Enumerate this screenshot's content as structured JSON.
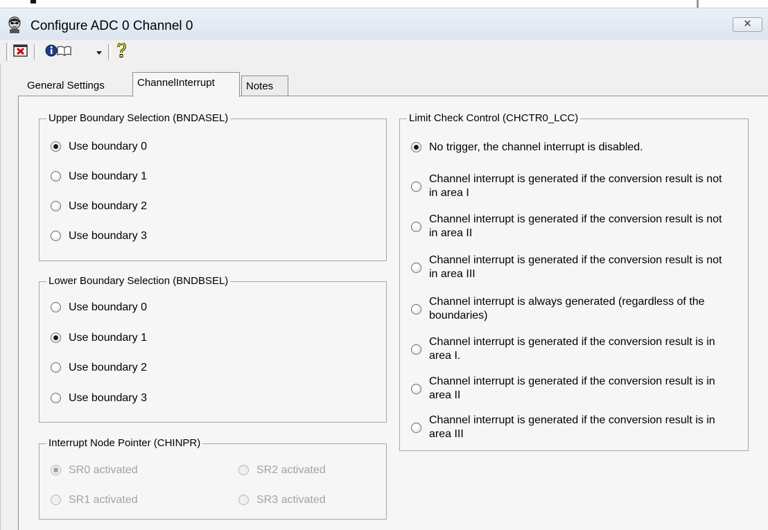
{
  "window": {
    "title": "Configure ADC 0 Channel 0",
    "close_icon": "close-icon"
  },
  "toolbar": {
    "icons": [
      "close-document-icon",
      "info-book-icon",
      "dropdown-arrow-icon",
      "help-icon"
    ]
  },
  "tabs": [
    {
      "label": "General Settings",
      "active": false
    },
    {
      "label": "ChannelInterrupt",
      "active": true
    },
    {
      "label": "Notes",
      "active": false
    }
  ],
  "upper_boundary": {
    "title": "Upper Boundary Selection (BNDASEL)",
    "options": [
      "Use boundary 0",
      "Use boundary 1",
      "Use boundary 2",
      "Use boundary 3"
    ],
    "selected": 0
  },
  "lower_boundary": {
    "title": "Lower Boundary Selection (BNDBSEL)",
    "options": [
      "Use boundary 0",
      "Use boundary 1",
      "Use boundary 2",
      "Use boundary 3"
    ],
    "selected": 1
  },
  "interrupt_node": {
    "title": "Interrupt Node Pointer (CHINPR)",
    "options": [
      "SR0 activated",
      "SR1 activated",
      "SR2 activated",
      "SR3 activated"
    ],
    "selected": 0,
    "disabled": true
  },
  "limit_check": {
    "title": "Limit Check Control (CHCTR0_LCC)",
    "options": [
      "No trigger, the channel interrupt is disabled.",
      "Channel interrupt is generated if the conversion result is not in area I",
      "Channel interrupt is generated if the conversion result is not in area II",
      "Channel interrupt is generated if the conversion result is not in area III",
      "Channel interrupt is always generated (regardless of the boundaries)",
      "Channel interrupt is generated if the conversion result is in area I.",
      "Channel interrupt is generated if the conversion result is in area II",
      "Channel interrupt is generated if the conversion result is in area III"
    ],
    "selected": 0
  }
}
